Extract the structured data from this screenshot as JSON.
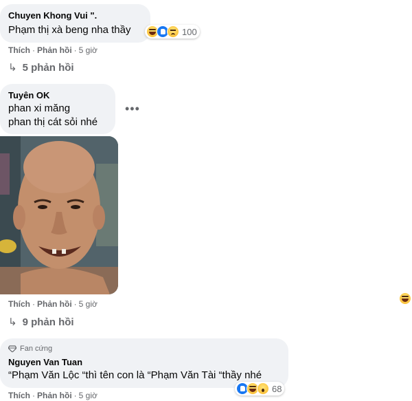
{
  "comments": [
    {
      "author": "Chuyen Khong Vui \".",
      "text": "Phạm thị xà beng nha thầy",
      "reactions": [
        "haha-icon",
        "like-icon",
        "sad-icon"
      ],
      "reaction_count": "100",
      "like_label": "Thích",
      "reply_label": "Phản hồi",
      "time": "5 giờ",
      "replies_label": "5 phản hồi"
    },
    {
      "author": "Tuyên OK",
      "lines": [
        "phan xi măng",
        "phan thị cát sỏi nhé"
      ],
      "like_label": "Thích",
      "reply_label": "Phản hồi",
      "time": "5 giờ",
      "replies_label": "9 phản hồi"
    },
    {
      "badge": "Fan cứng",
      "author": "Nguyen Van Tuan",
      "text": "“Phạm Văn Lộc “thì tên con là “Phạm Văn Tài “thầy nhé",
      "reactions": [
        "like-icon",
        "haha-icon",
        "wow-icon"
      ],
      "reaction_count": "68",
      "like_label": "Thích",
      "reply_label": "Phản hồi",
      "time": "5 giờ"
    }
  ],
  "separator": "·",
  "reply_arrow": "↳",
  "more_options": "•••",
  "colors": {
    "bubble": "#f0f2f5",
    "secondary_text": "#65676b",
    "like_blue": "#1877f2",
    "haha_yellow": "#fcc43d"
  }
}
